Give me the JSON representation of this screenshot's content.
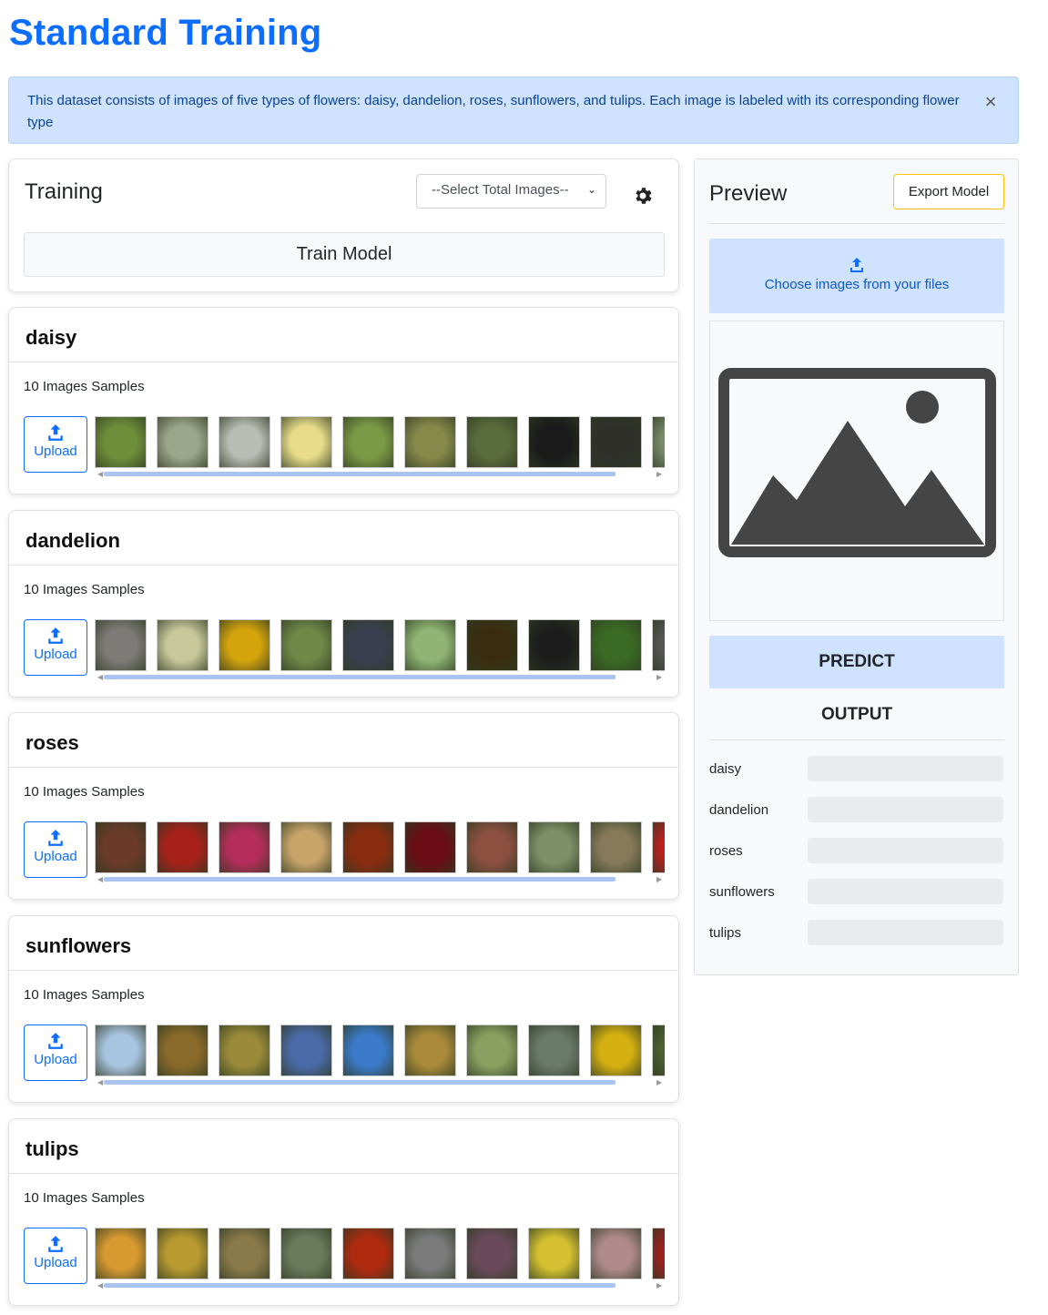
{
  "page": {
    "title": "Standard Training"
  },
  "alert": {
    "text": "This dataset consists of images of five types of flowers: daisy, dandelion, roses, sunflowers, and tulips. Each image is labeled with its corresponding flower type",
    "close": "×"
  },
  "training": {
    "title": "Training",
    "select_value": "--Select Total Images--",
    "settings_icon": "gear-icon",
    "train_label": "Train Model"
  },
  "classes": [
    {
      "name": "daisy",
      "samples": "10 Images Samples",
      "upload": "Upload",
      "thumb_colors": [
        "#6e8f3a",
        "#9aa589",
        "#b8bcb4",
        "#e8dc8a",
        "#7b9a45",
        "#86894a",
        "#5a6b3c",
        "#1a1a1a",
        "#2f2f2a",
        "#7a8d6a"
      ]
    },
    {
      "name": "dandelion",
      "samples": "10 Images Samples",
      "upload": "Upload",
      "thumb_colors": [
        "#7d7b77",
        "#c7c79a",
        "#d4a40c",
        "#6f8848",
        "#3a4050",
        "#8fb473",
        "#3a2d0f",
        "#1d1d1d",
        "#3a6a24",
        "#555555"
      ]
    },
    {
      "name": "roses",
      "samples": "10 Images Samples",
      "upload": "Upload",
      "thumb_colors": [
        "#6b3a2a",
        "#a8201a",
        "#b52d5a",
        "#c8a46a",
        "#8a2c10",
        "#6a0d14",
        "#8b5040",
        "#7d9068",
        "#867a5a",
        "#c02020"
      ]
    },
    {
      "name": "sunflowers",
      "samples": "10 Images Samples",
      "upload": "Upload",
      "thumb_colors": [
        "#a8c4e0",
        "#8a6a2a",
        "#9a8a3a",
        "#4a6aa8",
        "#3a7ac8",
        "#a88a3a",
        "#8aa060",
        "#6a7a6a",
        "#d4b010",
        "#4a6030"
      ]
    },
    {
      "name": "tulips",
      "samples": "10 Images Samples",
      "upload": "Upload",
      "thumb_colors": [
        "#d89a30",
        "#b89a30",
        "#8a7a4a",
        "#6a7a5a",
        "#b02a10",
        "#7a7a7a",
        "#6a4a5a",
        "#d4c030",
        "#b08a8a",
        "#a02020"
      ]
    }
  ],
  "preview": {
    "title": "Preview",
    "export_label": "Export Model",
    "choose_label": "Choose images from your files",
    "predict_label": "PREDICT",
    "output_title": "OUTPUT",
    "outputs": [
      {
        "label": "daisy",
        "value": 0
      },
      {
        "label": "dandelion",
        "value": 0
      },
      {
        "label": "roses",
        "value": 0
      },
      {
        "label": "sunflowers",
        "value": 0
      },
      {
        "label": "tulips",
        "value": 0
      }
    ]
  }
}
